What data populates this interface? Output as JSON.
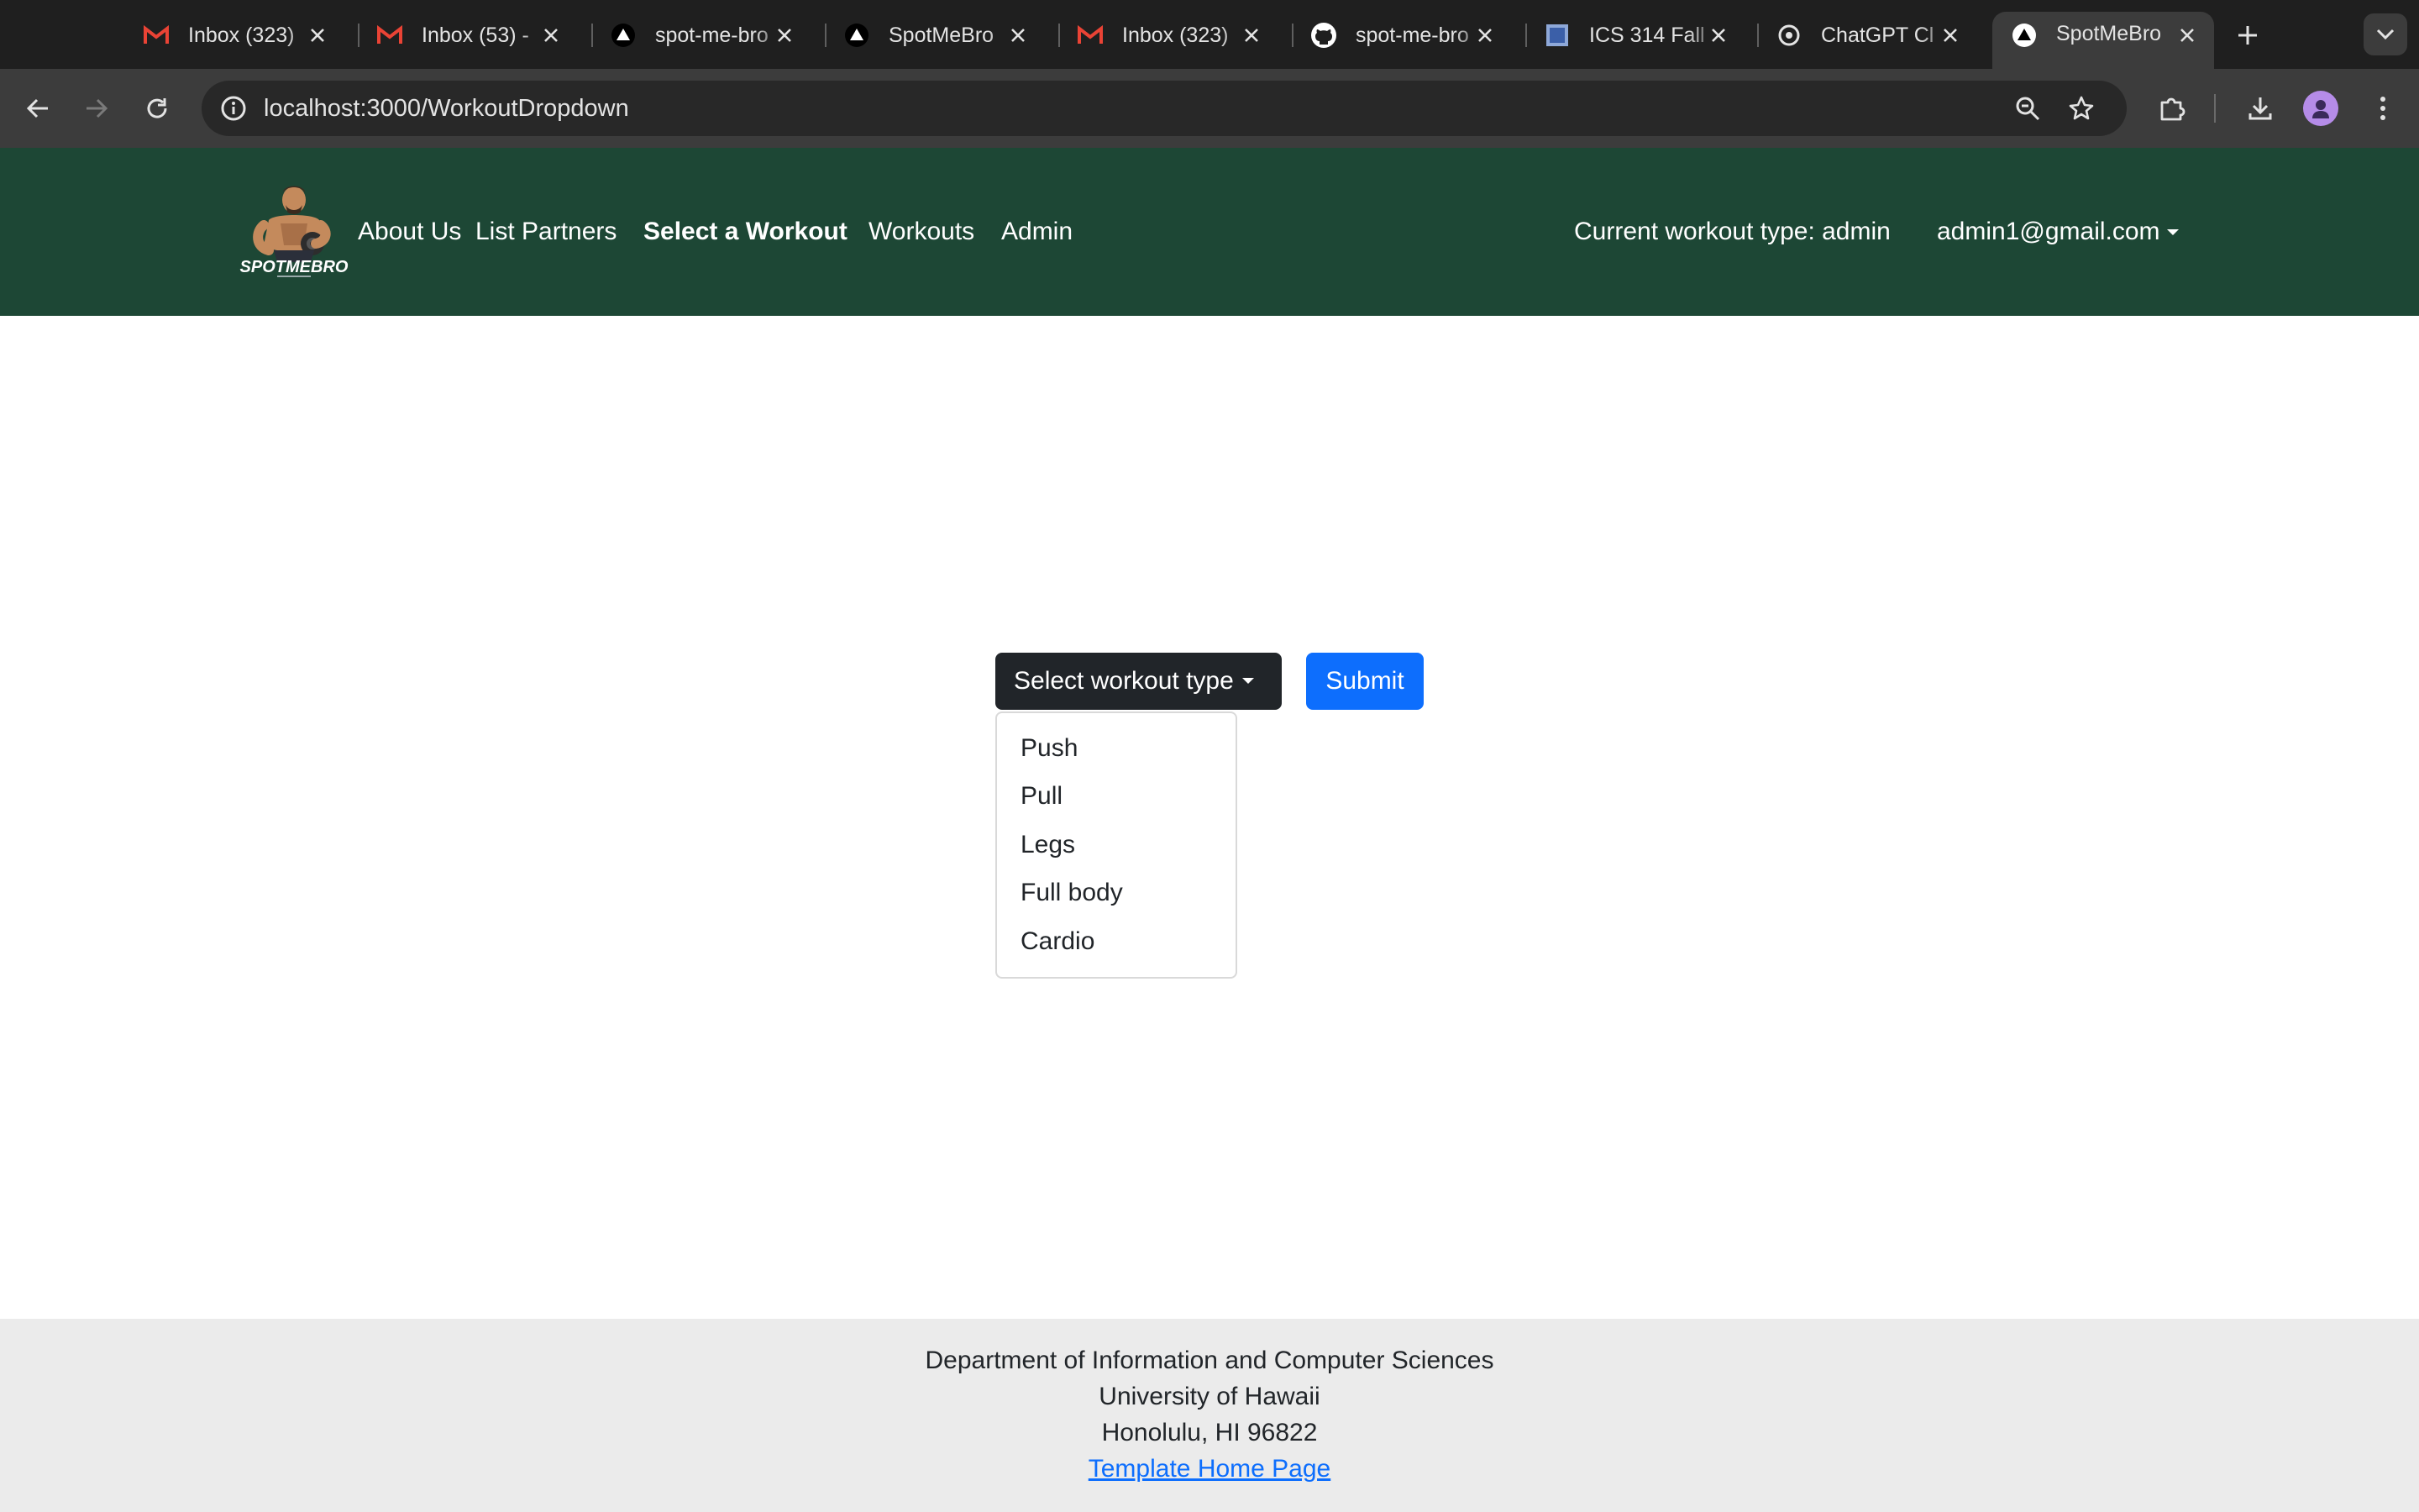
{
  "browser": {
    "tabs": [
      {
        "title": "Inbox (323)",
        "icon": "gmail-icon"
      },
      {
        "title": "Inbox (53) - ",
        "icon": "gmail-icon"
      },
      {
        "title": "spot-me-bro",
        "icon": "triangle-logo-icon"
      },
      {
        "title": "SpotMeBro",
        "icon": "triangle-logo-icon"
      },
      {
        "title": "Inbox (323)",
        "icon": "gmail-icon"
      },
      {
        "title": "spot-me-bro",
        "icon": "github-icon"
      },
      {
        "title": "ICS 314 Fall",
        "icon": "square-icon"
      },
      {
        "title": "ChatGPT Cl",
        "icon": "openai-icon"
      },
      {
        "title": "SpotMeBro",
        "icon": "triangle-logo-icon",
        "active": true
      }
    ],
    "url": "localhost:3000/WorkoutDropdown"
  },
  "navbar": {
    "logo_text": "SPOTMEBRO",
    "links": [
      "About Us",
      "List Partners",
      "Select a Workout",
      "Workouts",
      "Admin"
    ],
    "active_link": "Select a Workout",
    "current_workout": "Current workout type: admin",
    "user_email": "admin1@gmail.com"
  },
  "workout_form": {
    "dropdown_label": "Select workout type",
    "submit_label": "Submit",
    "options": [
      "Push",
      "Pull",
      "Legs",
      "Full body",
      "Cardio"
    ]
  },
  "footer": {
    "line1": "Department of Information and Computer Sciences",
    "line2": "University of Hawaii",
    "line3": "Honolulu, HI 96822",
    "link": "Template Home Page"
  },
  "colors": {
    "navbar_bg": "#1d4735",
    "primary_button": "#0d6efd",
    "dark_button": "#212529",
    "footer_bg": "#ebebeb"
  }
}
